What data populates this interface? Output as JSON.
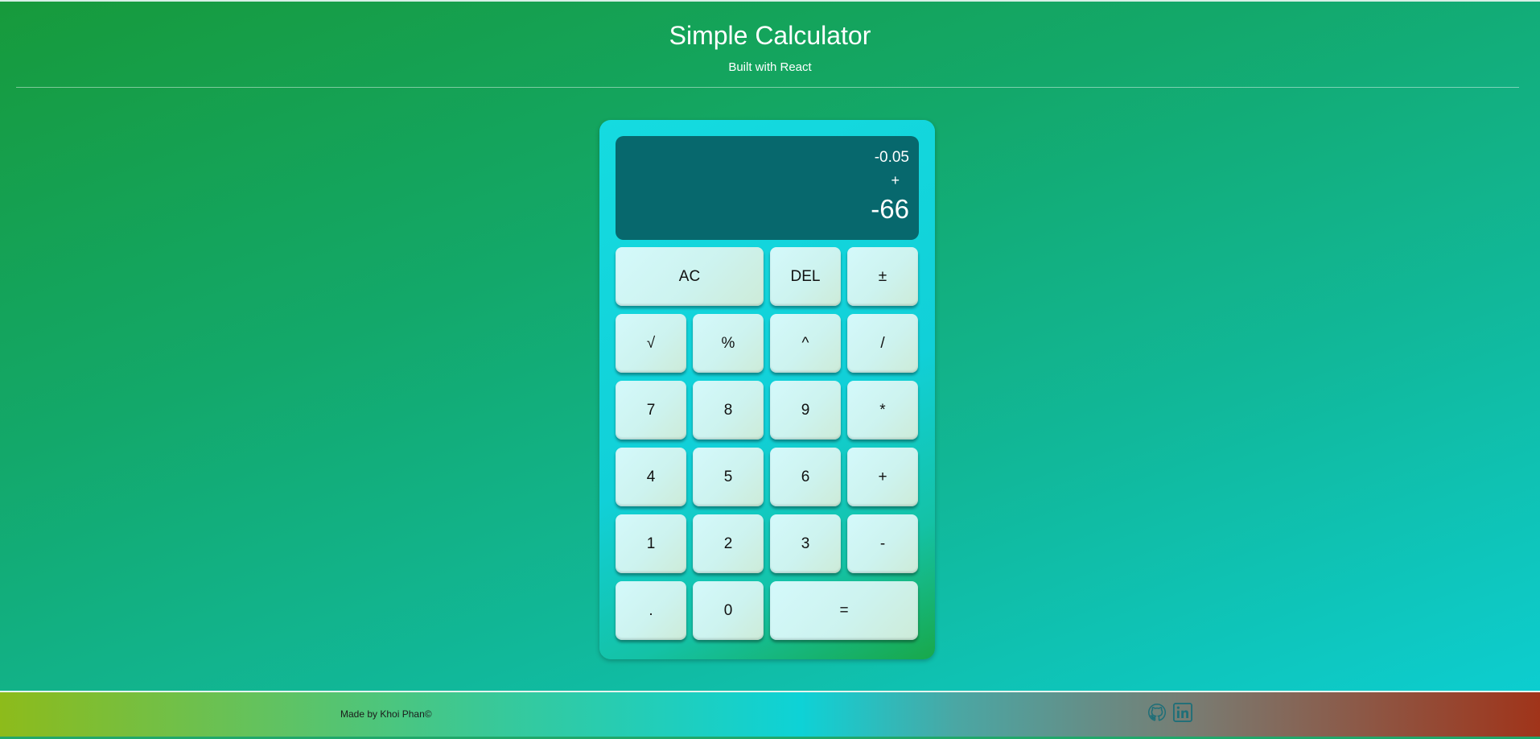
{
  "header": {
    "title": "Simple Calculator",
    "subtitle": "Built with React"
  },
  "calculator": {
    "display": {
      "previous": "-0.05",
      "operator": "+",
      "current": "-66"
    },
    "keys": {
      "ac": "AC",
      "del": "DEL",
      "plus_minus": "±",
      "sqrt": "√",
      "percent": "%",
      "power": "^",
      "divide": "/",
      "seven": "7",
      "eight": "8",
      "nine": "9",
      "multiply": "*",
      "four": "4",
      "five": "5",
      "six": "6",
      "add": "+",
      "one": "1",
      "two": "2",
      "three": "3",
      "subtract": "-",
      "decimal": ".",
      "zero": "0",
      "equals": "="
    }
  },
  "footer": {
    "credit": "Made by Khoi Phan©",
    "icons": [
      "github-icon",
      "linkedin-icon"
    ]
  },
  "colors": {
    "display_bg": "#07686d",
    "key_bg": "#d4f9fb",
    "calc_body": "#11d0d8"
  }
}
